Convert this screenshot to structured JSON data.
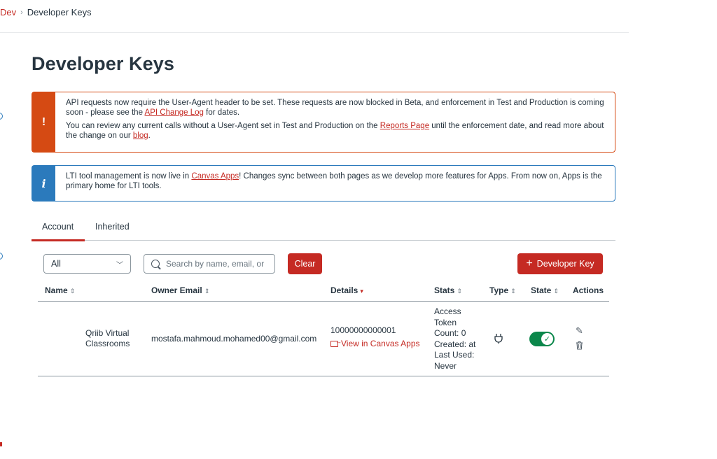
{
  "breadcrumb": {
    "root": "Dev",
    "current": "Developer Keys"
  },
  "page": {
    "title": "Developer Keys"
  },
  "alerts": {
    "warning": {
      "icon": "!",
      "line1_pre": "API requests now require the User-Agent header to be set. These requests are now blocked in Beta, and enforcement in Test and Production is coming soon - please see the ",
      "line1_link": "API Change Log",
      "line1_post": " for dates.",
      "line2_pre": "You can review any current calls without a User-Agent set in Test and Production on the ",
      "line2_link": "Reports Page",
      "line2_mid": " until the enforcement date, and read more about the change on our ",
      "line2_link2": "blog",
      "line2_post": "."
    },
    "info": {
      "icon": "i",
      "text_pre": "LTI tool management is now live in ",
      "text_link": "Canvas Apps",
      "text_post": "! Changes sync between both pages as we develop more features for Apps. From now on, Apps is the primary home for LTI tools."
    }
  },
  "tabs": [
    {
      "label": "Account",
      "active": true
    },
    {
      "label": "Inherited",
      "active": false
    }
  ],
  "filters": {
    "select_value": "All",
    "search_placeholder": "Search by name, email, or",
    "clear_label": "Clear",
    "add_key_label": "Developer Key"
  },
  "table": {
    "headers": {
      "name": "Name",
      "owner_email": "Owner Email",
      "details": "Details",
      "stats": "Stats",
      "type": "Type",
      "state": "State",
      "actions": "Actions"
    },
    "rows": [
      {
        "name_line1": "Qriib Virtual",
        "name_line2": "Classrooms",
        "owner_email": "mostafa.mahmoud.mohamed00@gmail.com",
        "key_id": "10000000000001",
        "view_link": "View in Canvas Apps",
        "stats": [
          "Access",
          "Token",
          "Count: 0",
          "Created: at",
          "Last Used:",
          "Never"
        ],
        "type_icon": "plug-icon",
        "state": "on"
      }
    ]
  },
  "colors": {
    "brand": "#c52a23",
    "warning": "#d54a13",
    "info": "#2b7abc",
    "success": "#0b874b"
  }
}
